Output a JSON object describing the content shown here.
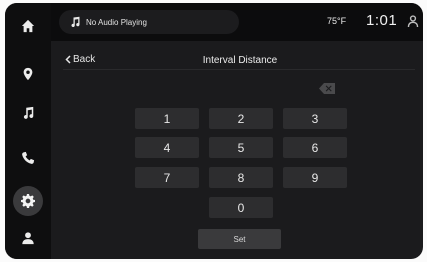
{
  "nav": {
    "items": [
      {
        "icon": "home-icon"
      },
      {
        "icon": "map-pin-icon"
      },
      {
        "icon": "music-note-icon"
      },
      {
        "icon": "phone-icon"
      },
      {
        "icon": "gear-icon",
        "active": true
      },
      {
        "icon": "person-icon"
      }
    ]
  },
  "status_bar": {
    "now_playing": "No Audio Playing",
    "temperature": "75°F",
    "time": "1:01"
  },
  "header": {
    "back_label": "Back",
    "title": "Interval Distance"
  },
  "keypad": {
    "keys": [
      "1",
      "2",
      "3",
      "4",
      "5",
      "6",
      "7",
      "8",
      "9",
      "0"
    ],
    "set_label": "Set"
  },
  "colors": {
    "background": "#1b1b1d",
    "rail": "#0e0e0f",
    "key": "#2d2d2f",
    "set_button": "#3a3a3c",
    "text": "#e8e8e8"
  }
}
